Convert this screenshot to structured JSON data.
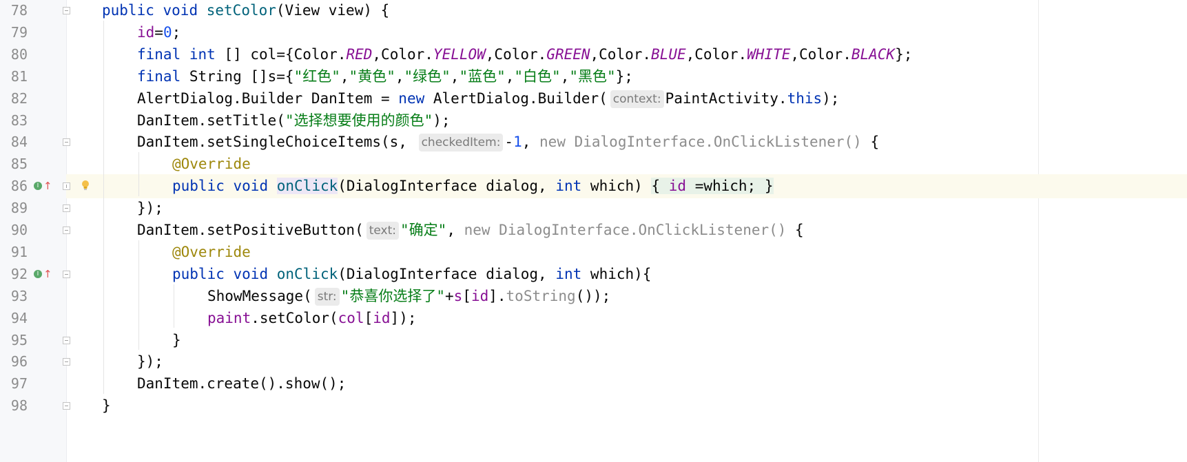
{
  "editor": {
    "language": "java",
    "current_line": "86",
    "colors": {
      "keyword": "#0033b3",
      "field": "#871094",
      "string": "#067d17",
      "number": "#1750eb",
      "annotation": "#9e880d",
      "method": "#00627a",
      "comment_gray": "#8c8c8c"
    },
    "gutter_icons": {
      "implements": "implements-icon",
      "overrides": "overrides-arrow-icon",
      "intention": "lightbulb-icon",
      "fold": "fold-marker-icon"
    }
  },
  "lines": [
    {
      "number": "78",
      "tokens": [
        {
          "t": "public",
          "c": "k"
        },
        {
          "t": " "
        },
        {
          "t": "void",
          "c": "k"
        },
        {
          "t": " "
        },
        {
          "t": "setColor",
          "c": "m"
        },
        {
          "t": "(View view) {"
        }
      ]
    },
    {
      "number": "79",
      "tokens": [
        {
          "t": "id",
          "c": "f"
        },
        {
          "t": "="
        },
        {
          "t": "0",
          "c": "n"
        },
        {
          "t": ";"
        }
      ]
    },
    {
      "number": "80",
      "tokens": [
        {
          "t": "final",
          "c": "k"
        },
        {
          "t": " "
        },
        {
          "t": "int",
          "c": "k"
        },
        {
          "t": " [] col={Color."
        },
        {
          "t": "RED",
          "c": "fs"
        },
        {
          "t": ",Color."
        },
        {
          "t": "YELLOW",
          "c": "fs"
        },
        {
          "t": ",Color."
        },
        {
          "t": "GREEN",
          "c": "fs"
        },
        {
          "t": ",Color."
        },
        {
          "t": "BLUE",
          "c": "fs"
        },
        {
          "t": ",Color."
        },
        {
          "t": "WHITE",
          "c": "fs"
        },
        {
          "t": ",Color."
        },
        {
          "t": "BLACK",
          "c": "fs"
        },
        {
          "t": "};"
        }
      ]
    },
    {
      "number": "81",
      "tokens": [
        {
          "t": "final",
          "c": "k"
        },
        {
          "t": " String []s={"
        },
        {
          "t": "\"红色\"",
          "c": "s"
        },
        {
          "t": ","
        },
        {
          "t": "\"黄色\"",
          "c": "s"
        },
        {
          "t": ","
        },
        {
          "t": "\"绿色\"",
          "c": "s"
        },
        {
          "t": ","
        },
        {
          "t": "\"蓝色\"",
          "c": "s"
        },
        {
          "t": ","
        },
        {
          "t": "\"白色\"",
          "c": "s"
        },
        {
          "t": ","
        },
        {
          "t": "\"黑色\"",
          "c": "s"
        },
        {
          "t": "};"
        }
      ]
    },
    {
      "number": "82",
      "tokens": [
        {
          "t": "AlertDialog.Builder DanItem = "
        },
        {
          "t": "new",
          "c": "k"
        },
        {
          "t": " AlertDialog.Builder("
        },
        {
          "t": "context:",
          "c": "hint"
        },
        {
          "t": "PaintActivity."
        },
        {
          "t": "this",
          "c": "k"
        },
        {
          "t": ");"
        }
      ]
    },
    {
      "number": "83",
      "tokens": [
        {
          "t": "DanItem.setTitle("
        },
        {
          "t": "\"选择想要使用的颜色\"",
          "c": "s"
        },
        {
          "t": ");"
        }
      ]
    },
    {
      "number": "84",
      "tokens": [
        {
          "t": "DanItem.setSingleChoiceItems(s, "
        },
        {
          "t": "checkedItem:",
          "c": "hint"
        },
        {
          "t": "-"
        },
        {
          "t": "1",
          "c": "n"
        },
        {
          "t": ", "
        },
        {
          "t": "new DialogInterface.OnClickListener()",
          "c": "g"
        },
        {
          "t": " {"
        }
      ]
    },
    {
      "number": "85",
      "tokens": [
        {
          "t": "@Override",
          "c": "a"
        }
      ]
    },
    {
      "number": "86",
      "tokens": [
        {
          "t": "public",
          "c": "k"
        },
        {
          "t": " "
        },
        {
          "t": "void",
          "c": "k"
        },
        {
          "t": " "
        },
        {
          "t": "onClick",
          "c": "m usage"
        },
        {
          "t": "(DialogInterface dialog, "
        },
        {
          "t": "int",
          "c": "k"
        },
        {
          "t": " which) "
        },
        {
          "t": "{",
          "c": "lambda"
        },
        {
          "t": " ",
          "c": "lambda"
        },
        {
          "t": "id",
          "c": "f lambda"
        },
        {
          "t": " =which; ",
          "c": "lambda"
        },
        {
          "t": "}",
          "c": "lambda"
        }
      ]
    },
    {
      "number": "89",
      "tokens": [
        {
          "t": "});"
        }
      ]
    },
    {
      "number": "90",
      "tokens": [
        {
          "t": "DanItem.setPositiveButton("
        },
        {
          "t": "text:",
          "c": "hint"
        },
        {
          "t": "\"确定\"",
          "c": "s"
        },
        {
          "t": ", "
        },
        {
          "t": "new DialogInterface.OnClickListener()",
          "c": "g"
        },
        {
          "t": " {"
        }
      ]
    },
    {
      "number": "91",
      "tokens": [
        {
          "t": "@Override",
          "c": "a"
        }
      ]
    },
    {
      "number": "92",
      "tokens": [
        {
          "t": "public",
          "c": "k"
        },
        {
          "t": " "
        },
        {
          "t": "void",
          "c": "k"
        },
        {
          "t": " "
        },
        {
          "t": "onClick",
          "c": "m"
        },
        {
          "t": "(DialogInterface dialog, "
        },
        {
          "t": "int",
          "c": "k"
        },
        {
          "t": " which){"
        }
      ]
    },
    {
      "number": "93",
      "tokens": [
        {
          "t": "ShowMessage("
        },
        {
          "t": "str:",
          "c": "hint"
        },
        {
          "t": "\"恭喜你选择了\"",
          "c": "s"
        },
        {
          "t": "+"
        },
        {
          "t": "s",
          "c": "f"
        },
        {
          "t": "["
        },
        {
          "t": "id",
          "c": "f"
        },
        {
          "t": "]."
        },
        {
          "t": "toString",
          "c": "g"
        },
        {
          "t": "());"
        }
      ]
    },
    {
      "number": "94",
      "tokens": [
        {
          "t": "paint",
          "c": "f"
        },
        {
          "t": ".setColor("
        },
        {
          "t": "col",
          "c": "f"
        },
        {
          "t": "["
        },
        {
          "t": "id",
          "c": "f"
        },
        {
          "t": "]);"
        }
      ]
    },
    {
      "number": "95",
      "tokens": [
        {
          "t": "}"
        }
      ]
    },
    {
      "number": "96",
      "tokens": [
        {
          "t": "});"
        }
      ]
    },
    {
      "number": "97",
      "tokens": [
        {
          "t": "DanItem.create().show();"
        }
      ]
    },
    {
      "number": "98",
      "tokens": [
        {
          "t": "}"
        }
      ]
    }
  ]
}
